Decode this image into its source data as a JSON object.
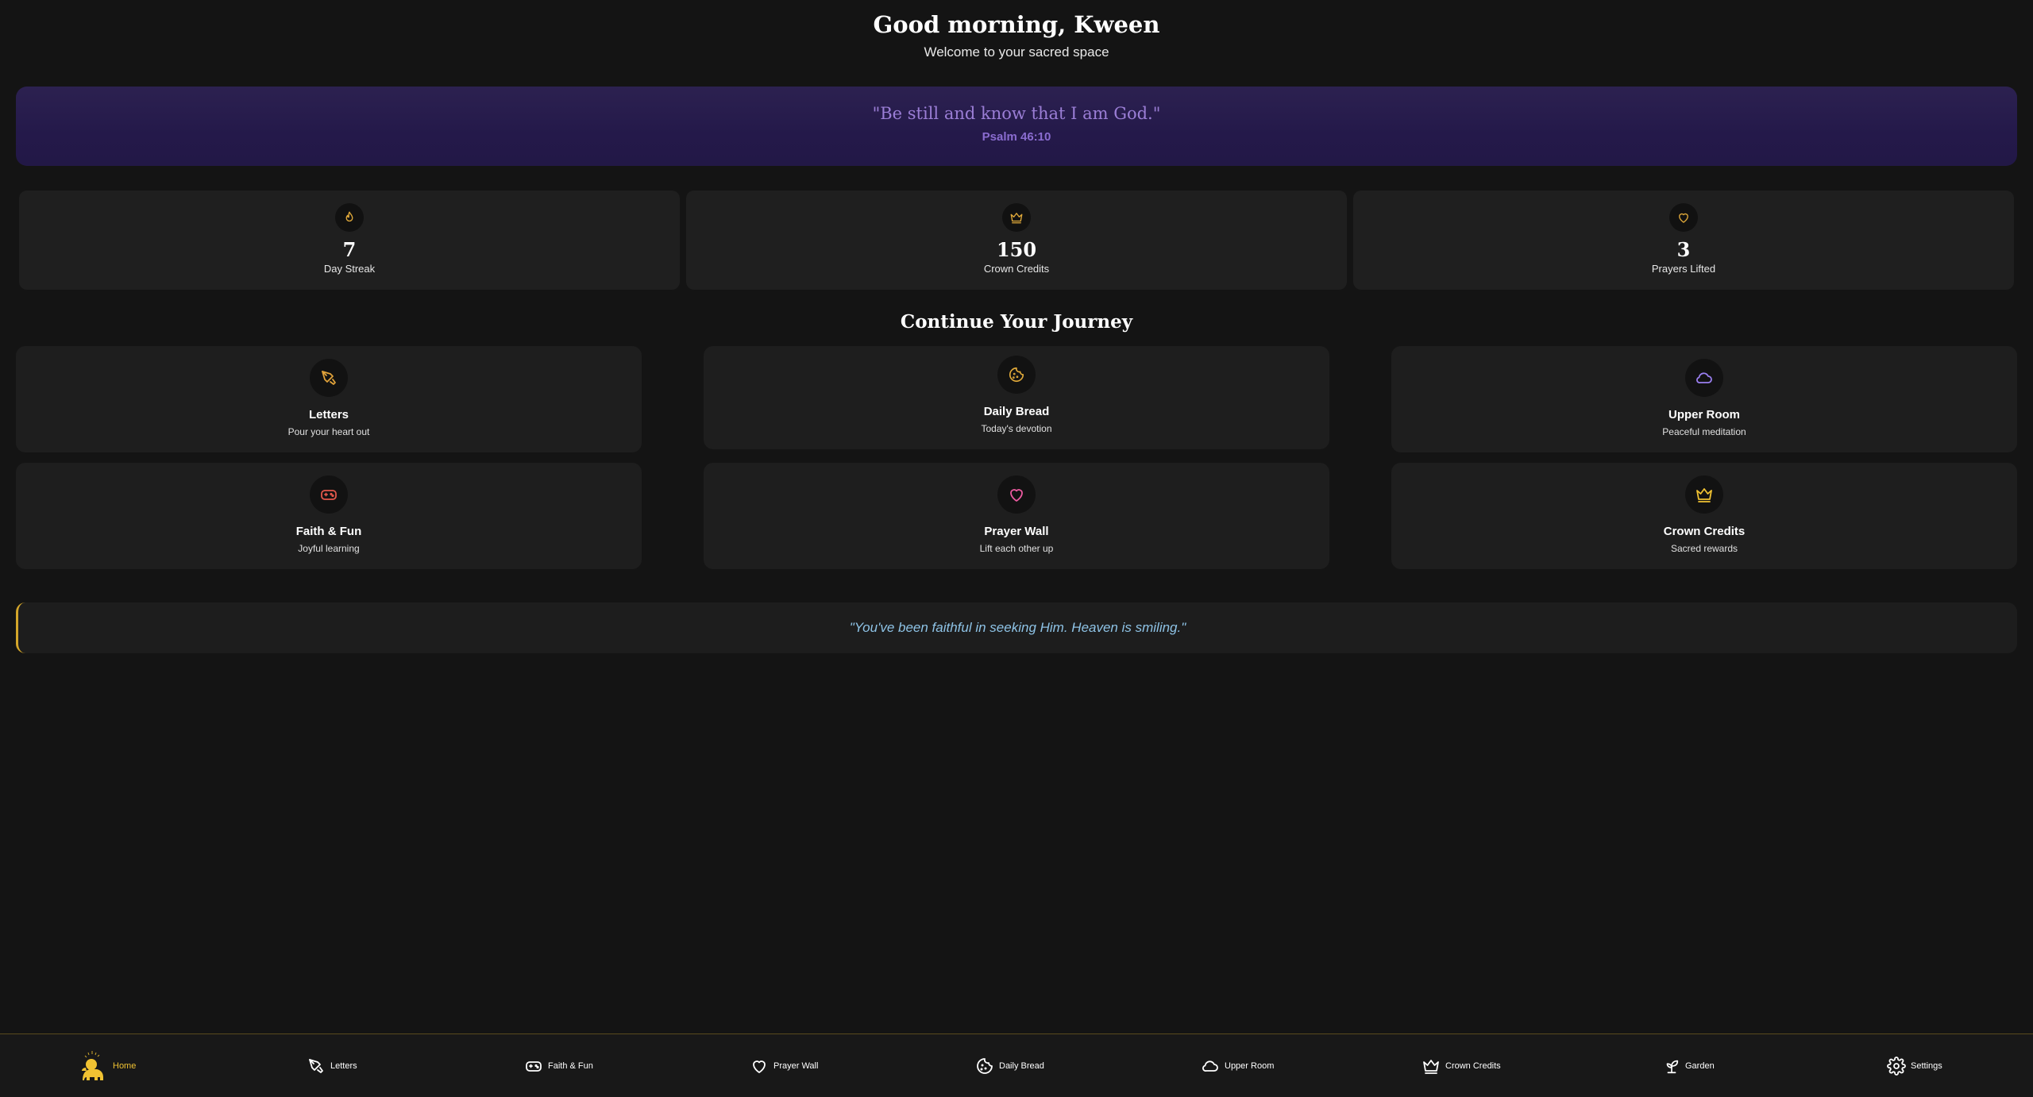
{
  "header": {
    "greeting": "Good morning, Kween",
    "welcome": "Welcome to your sacred space"
  },
  "verse": {
    "text": "\"Be still and know that I am God.\"",
    "reference": "Psalm 46:10"
  },
  "stats": [
    {
      "icon": "flame-icon",
      "value": "7",
      "label": "Day Streak"
    },
    {
      "icon": "crown-icon",
      "value": "150",
      "label": "Crown Credits"
    },
    {
      "icon": "heart-icon",
      "value": "3",
      "label": "Prayers Lifted"
    }
  ],
  "journey": {
    "title": "Continue Your Journey",
    "cards": [
      {
        "icon": "feather-pen-icon",
        "title": "Letters",
        "subtitle": "Pour your heart out"
      },
      {
        "icon": "cookie-bread-icon",
        "title": "Daily Bread",
        "subtitle": "Today's devotion"
      },
      {
        "icon": "cloud-icon",
        "title": "Upper Room",
        "subtitle": "Peaceful meditation"
      },
      {
        "icon": "gamepad-icon",
        "title": "Faith & Fun",
        "subtitle": "Joyful learning"
      },
      {
        "icon": "heart-icon",
        "title": "Prayer Wall",
        "subtitle": "Lift each other up"
      },
      {
        "icon": "crown-icon",
        "title": "Crown Credits",
        "subtitle": "Sacred rewards"
      }
    ]
  },
  "encouragement": "\"You've been faithful in seeking Him. Heaven is smiling.\"",
  "nav": {
    "items": [
      {
        "icon": "lion-icon",
        "label": "Home",
        "active": true
      },
      {
        "icon": "feather-pen-icon",
        "label": "Letters"
      },
      {
        "icon": "gamepad-icon",
        "label": "Faith & Fun"
      },
      {
        "icon": "heart-icon",
        "label": "Prayer Wall"
      },
      {
        "icon": "cookie-bread-icon",
        "label": "Daily Bread"
      },
      {
        "icon": "cloud-icon",
        "label": "Upper Room"
      },
      {
        "icon": "crown-icon",
        "label": "Crown Credits"
      },
      {
        "icon": "sprout-icon",
        "label": "Garden"
      },
      {
        "icon": "gear-icon",
        "label": "Settings"
      }
    ]
  },
  "colors": {
    "background": "#141414",
    "accent_gold": "#f0c232",
    "verse_purple": "#9b7ed6",
    "quote_blue": "#8ec3e6",
    "prayer_pink": "#ec5aa0",
    "game_red": "#e4584b",
    "cloud_purple": "#9a7ff0"
  }
}
